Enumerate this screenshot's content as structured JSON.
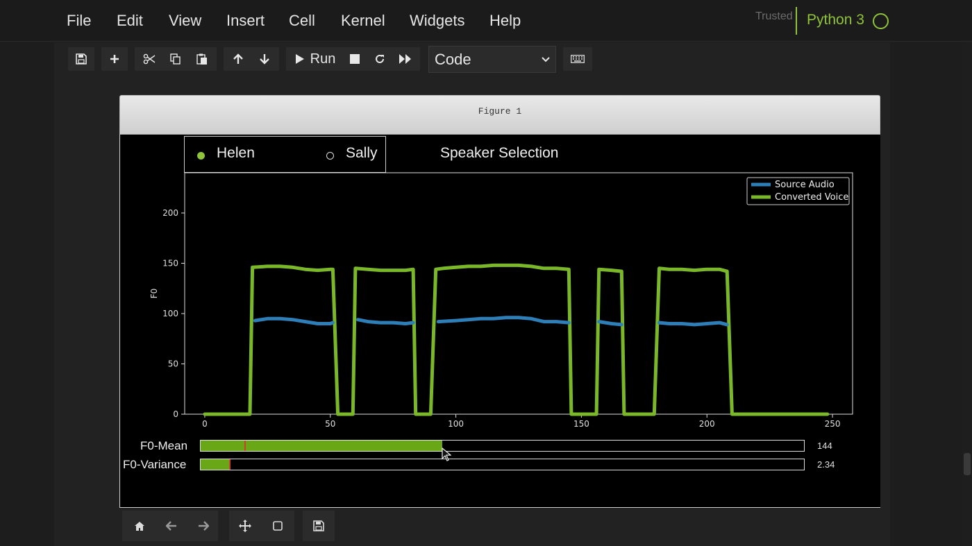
{
  "menubar": {
    "items": [
      "File",
      "Edit",
      "View",
      "Insert",
      "Cell",
      "Kernel",
      "Widgets",
      "Help"
    ],
    "trusted": "Trusted",
    "kernel": "Python 3"
  },
  "toolbar": {
    "run_label": "Run",
    "cell_type": "Code"
  },
  "figure": {
    "title": "Figure 1",
    "radio": {
      "options": [
        "Helen",
        "Sally"
      ],
      "selected": "Helen"
    },
    "speaker_title": "Speaker Selection",
    "sliders": [
      {
        "label": "F0-Mean",
        "value_text": "144",
        "fill_fraction": 0.4,
        "initial_fraction": 0.072
      },
      {
        "label": "F0-Variance",
        "value_text": "2.34",
        "fill_fraction": 0.047,
        "initial_fraction": 0.047
      }
    ]
  },
  "colors": {
    "accent": "#8fc43b",
    "source": "#2e7fb8",
    "converted": "#7ab82a",
    "slider_fill": "#6aa716",
    "slider_marker": "#c8402e"
  },
  "chart_data": {
    "type": "line",
    "ylabel": "F0",
    "xlabel": "",
    "xlim": [
      -8,
      258
    ],
    "ylim": [
      0,
      240
    ],
    "xticks": [
      0,
      50,
      100,
      150,
      200,
      250
    ],
    "yticks": [
      0,
      50,
      100,
      150,
      200
    ],
    "legend": "top-right",
    "series": [
      {
        "name": "Source Audio",
        "segments": [
          [
            [
              20,
              93
            ],
            [
              25,
              95
            ],
            [
              30,
              95
            ],
            [
              35,
              94
            ],
            [
              40,
              92
            ],
            [
              45,
              90
            ],
            [
              50,
              90
            ],
            [
              51,
              91
            ]
          ],
          [
            [
              61,
              94
            ],
            [
              65,
              92
            ],
            [
              70,
              91
            ],
            [
              75,
              91
            ],
            [
              80,
              90
            ],
            [
              83,
              91
            ]
          ],
          [
            [
              93,
              92
            ],
            [
              100,
              93
            ],
            [
              105,
              94
            ],
            [
              110,
              95
            ],
            [
              115,
              95
            ],
            [
              120,
              96
            ],
            [
              125,
              96
            ],
            [
              130,
              95
            ],
            [
              135,
              92
            ],
            [
              140,
              92
            ],
            [
              145,
              91
            ]
          ],
          [
            [
              157,
              92
            ],
            [
              162,
              90
            ],
            [
              166,
              89
            ]
          ],
          [
            [
              181,
              91
            ],
            [
              185,
              90
            ],
            [
              190,
              90
            ],
            [
              195,
              89
            ],
            [
              200,
              90
            ],
            [
              205,
              91
            ],
            [
              208,
              89
            ]
          ]
        ]
      },
      {
        "name": "Converted Voice",
        "segments": [
          [
            [
              0,
              0
            ],
            [
              18,
              0
            ],
            [
              19,
              146
            ],
            [
              25,
              147
            ],
            [
              30,
              147
            ],
            [
              35,
              146
            ],
            [
              40,
              144
            ],
            [
              45,
              143
            ],
            [
              50,
              144
            ],
            [
              51,
              144
            ],
            [
              53,
              0
            ],
            [
              59,
              0
            ],
            [
              60,
              145
            ],
            [
              65,
              144
            ],
            [
              70,
              143
            ],
            [
              75,
              143
            ],
            [
              80,
              143
            ],
            [
              83,
              144
            ],
            [
              84,
              0
            ],
            [
              90,
              0
            ],
            [
              92,
              144
            ],
            [
              95,
              145
            ],
            [
              100,
              146
            ],
            [
              105,
              147
            ],
            [
              110,
              147
            ],
            [
              115,
              148
            ],
            [
              120,
              148
            ],
            [
              125,
              148
            ],
            [
              130,
              147
            ],
            [
              135,
              145
            ],
            [
              140,
              145
            ],
            [
              145,
              144
            ],
            [
              146,
              0
            ],
            [
              156,
              0
            ],
            [
              157,
              144
            ],
            [
              162,
              143
            ],
            [
              166,
              142
            ],
            [
              167,
              0
            ],
            [
              179,
              0
            ],
            [
              181,
              145
            ],
            [
              185,
              144
            ],
            [
              190,
              144
            ],
            [
              195,
              143
            ],
            [
              200,
              144
            ],
            [
              205,
              144
            ],
            [
              208,
              142
            ],
            [
              210,
              0
            ],
            [
              248,
              0
            ]
          ]
        ]
      }
    ]
  }
}
